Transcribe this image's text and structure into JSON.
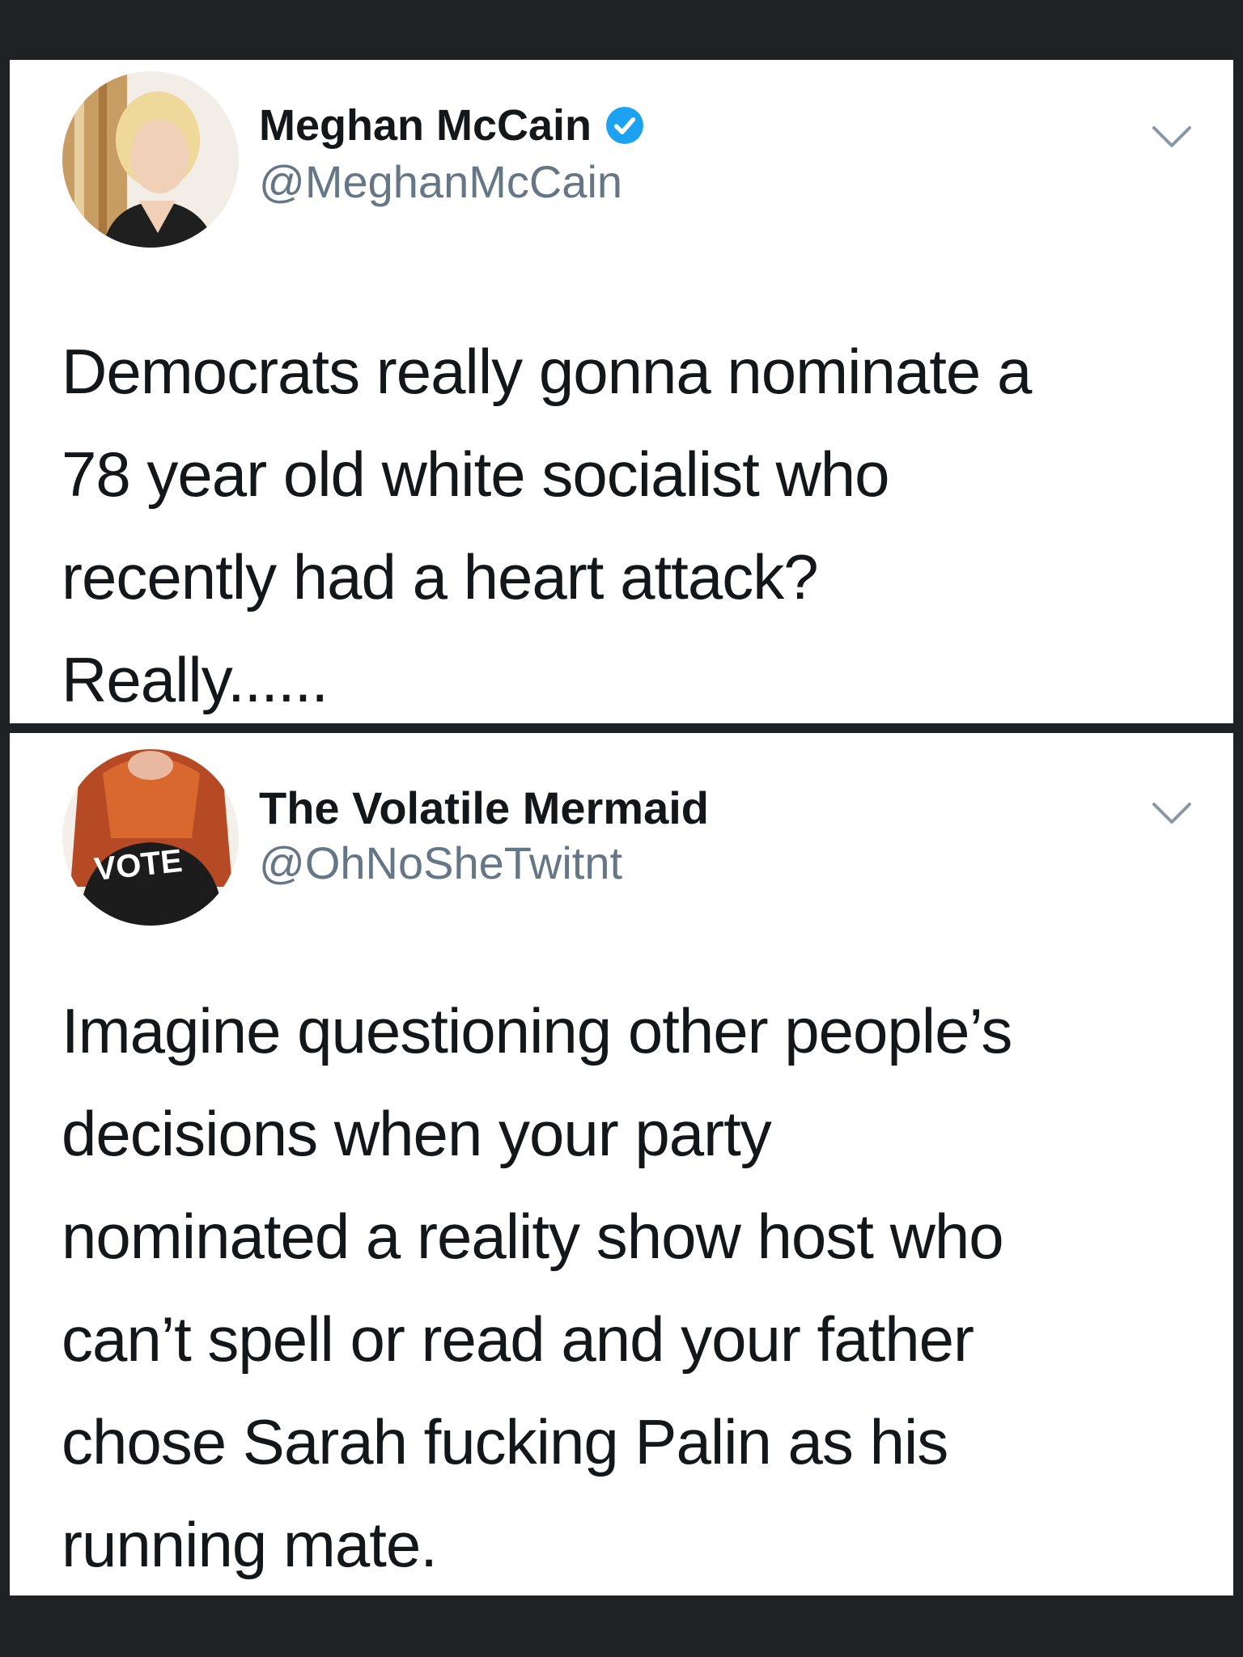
{
  "tweets": [
    {
      "name": "Meghan McCain",
      "handle": "@MeghanMcCain",
      "verified": true,
      "text_lines": [
        "Democrats really gonna nominate a",
        "78 year old white socialist who",
        "recently had a heart attack?",
        "Really......"
      ]
    },
    {
      "name": "The Volatile Mermaid",
      "handle": "@OhNoSheTwitnt",
      "verified": false,
      "avatar_shirt_text": "VOTE",
      "text_lines": [
        "Imagine questioning other people’s",
        "decisions when your party",
        "nominated a reality show host who",
        "can’t spell or read and your father",
        "chose Sarah fucking Palin as his",
        "running mate."
      ]
    }
  ],
  "colors": {
    "verified_badge": "#1da1f2",
    "name_text": "#14171a",
    "handle_text": "#657786",
    "background": "#202124"
  },
  "icons": [
    "verified-badge-icon",
    "chevron-down-icon"
  ]
}
